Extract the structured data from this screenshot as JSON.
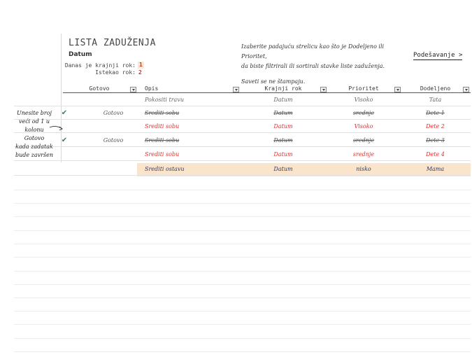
{
  "title": "LISTA ZADUŽENJA",
  "date_label": "Datum",
  "due_today_label": "Danas je krajnji rok:",
  "due_today_value": "1",
  "overdue_label": "Istekao rok:",
  "overdue_value": "2",
  "instructions": {
    "line1": "Izaberite padajuću strelicu kao što je Dodeljeno ili Prioritet,",
    "line2": "da biste filtrirali ili sortirali stavke liste zaduženja.",
    "line3": "Saveti se ne štampaju."
  },
  "settings_link": "Podešavanje >",
  "note": {
    "line1": "Unesite broj",
    "line2": "veći od 1 u",
    "line3": "kolonu Gotovo",
    "line4": "kada zadatak",
    "line5": "bude završen"
  },
  "columns": {
    "done": "Gotovo",
    "description": "Opis",
    "due": "Krajnji rok",
    "priority": "Prioritet",
    "assigned": "Dodeljeno"
  },
  "rows": [
    {
      "done": "",
      "description": "Pokositi travu",
      "due": "Datum",
      "priority": "Visoko",
      "assigned": "Tata",
      "state": "plain"
    },
    {
      "done": "Gotovo",
      "description": "Srediti sobu",
      "due": "Datum",
      "priority": "srednje",
      "assigned": "Dete 1",
      "state": "done"
    },
    {
      "done": "",
      "description": "Srediti sobu",
      "due": "Datum",
      "priority": "Visoko",
      "assigned": "Dete 2",
      "state": "overdue"
    },
    {
      "done": "Gotovo",
      "description": "Srediti sobu",
      "due": "Datum",
      "priority": "srednje",
      "assigned": "Dete 3",
      "state": "done"
    },
    {
      "done": "",
      "description": "Srediti sobu",
      "due": "Datum",
      "priority": "srednje",
      "assigned": "Dete 4",
      "state": "overdue"
    },
    {
      "done": "",
      "description": "Srediti ostavu",
      "due": "Datum",
      "priority": "nisko",
      "assigned": "Mama",
      "state": "due-today"
    }
  ],
  "colors": {
    "overdue": "#e03030",
    "due_today_fill": "#fbe4cc",
    "check": "#3a7a6a",
    "navy_text": "#2d3a66"
  },
  "icons": {
    "check": "check-icon",
    "dropdown": "dropdown-arrow-icon",
    "note_arrow": "curved-arrow-icon"
  }
}
